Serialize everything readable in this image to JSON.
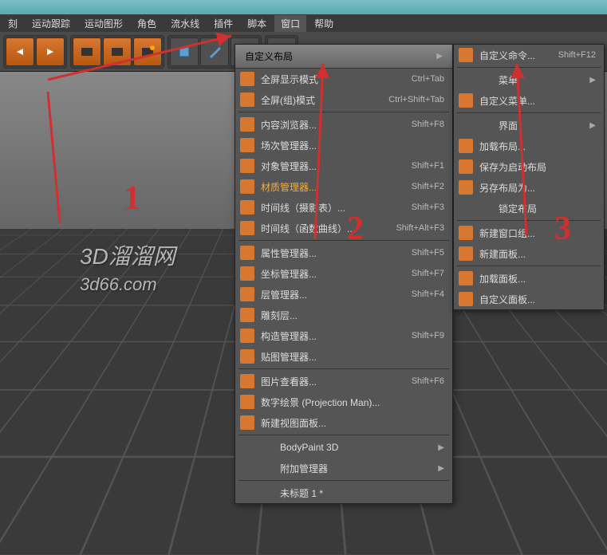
{
  "menubar": {
    "items": [
      "刻",
      "运动跟踪",
      "运动图形",
      "角色",
      "流水线",
      "插件",
      "脚本",
      "窗口",
      "帮助"
    ]
  },
  "menu1": {
    "header": "自定义布局",
    "groups": [
      [
        {
          "icon": "orange",
          "label": "全屏显示模式",
          "shortcut": "Ctrl+Tab"
        },
        {
          "icon": "orange",
          "label": "全屏(组)模式",
          "shortcut": "Ctrl+Shift+Tab"
        }
      ],
      [
        {
          "icon": "orange",
          "label": "内容浏览器...",
          "shortcut": "Shift+F8"
        },
        {
          "icon": "orange",
          "label": "场次管理器...",
          "shortcut": ""
        },
        {
          "icon": "orange",
          "label": "对象管理器...",
          "shortcut": "Shift+F1"
        },
        {
          "icon": "orange",
          "label": "材质管理器...",
          "shortcut": "Shift+F2",
          "highlight": true
        },
        {
          "icon": "orange",
          "label": "时间线（摄影表）...",
          "shortcut": "Shift+F3"
        },
        {
          "icon": "orange",
          "label": "时间线（函数曲线）...",
          "shortcut": "Shift+Alt+F3"
        }
      ],
      [
        {
          "icon": "orange",
          "label": "属性管理器...",
          "shortcut": "Shift+F5"
        },
        {
          "icon": "orange",
          "label": "坐标管理器...",
          "shortcut": "Shift+F7"
        },
        {
          "icon": "orange",
          "label": "层管理器...",
          "shortcut": "Shift+F4"
        },
        {
          "icon": "orange",
          "label": "雕刻层...",
          "shortcut": ""
        },
        {
          "icon": "orange",
          "label": "构造管理器...",
          "shortcut": "Shift+F9"
        },
        {
          "icon": "orange",
          "label": "贴图管理器...",
          "shortcut": ""
        }
      ],
      [
        {
          "icon": "orange",
          "label": "图片查看器...",
          "shortcut": "Shift+F6"
        },
        {
          "icon": "orange",
          "label": "数字绘景 (Projection Man)...",
          "shortcut": ""
        },
        {
          "icon": "orange",
          "label": "新建视图面板...",
          "shortcut": ""
        }
      ],
      [
        {
          "icon": "",
          "label": "BodyPaint 3D",
          "shortcut": "",
          "submenu": true,
          "indent": true
        },
        {
          "icon": "",
          "label": "附加管理器",
          "shortcut": "",
          "submenu": true,
          "indent": true
        }
      ],
      [
        {
          "icon": "",
          "label": "未标题 1 *",
          "shortcut": "",
          "indent": true
        }
      ]
    ]
  },
  "menu2": {
    "groups": [
      [
        {
          "icon": "orange",
          "label": "自定义命令...",
          "shortcut": "Shift+F12"
        }
      ],
      [
        {
          "icon": "",
          "label": "菜单",
          "submenu": true,
          "indent": true
        },
        {
          "icon": "orange",
          "label": "自定义菜单...",
          "shortcut": ""
        }
      ],
      [
        {
          "icon": "",
          "label": "界面",
          "submenu": true,
          "indent": true
        },
        {
          "icon": "orange",
          "label": "加载布局...",
          "shortcut": ""
        },
        {
          "icon": "orange",
          "label": "保存为启动布局",
          "shortcut": ""
        },
        {
          "icon": "orange",
          "label": "另存布局为...",
          "shortcut": ""
        },
        {
          "icon": "",
          "label": "锁定布局",
          "shortcut": "",
          "indent": true
        }
      ],
      [
        {
          "icon": "orange",
          "label": "新建窗口组...",
          "shortcut": ""
        },
        {
          "icon": "orange",
          "label": "新建面板...",
          "shortcut": ""
        }
      ],
      [
        {
          "icon": "orange",
          "label": "加载面板...",
          "shortcut": ""
        },
        {
          "icon": "orange",
          "label": "自定义面板...",
          "shortcut": ""
        }
      ]
    ]
  },
  "watermark": {
    "line1": "3D溜溜网",
    "line2": "3d66.com"
  },
  "annotations": {
    "n1": "1",
    "n2": "2",
    "n3": "3"
  }
}
